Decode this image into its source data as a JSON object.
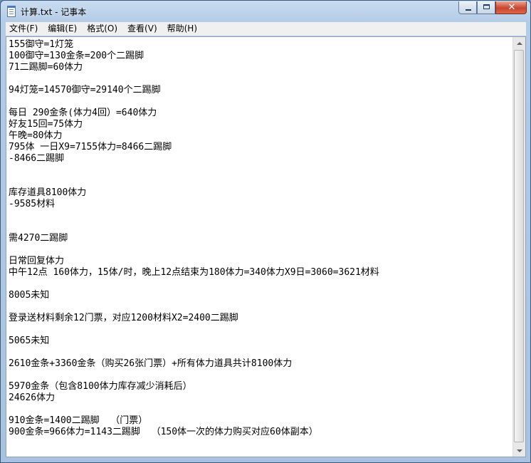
{
  "window": {
    "title": "计算.txt - 记事本"
  },
  "menu": {
    "items": [
      {
        "label": "文件(F)"
      },
      {
        "label": "编辑(E)"
      },
      {
        "label": "格式(O)"
      },
      {
        "label": "查看(V)"
      },
      {
        "label": "帮助(H)"
      }
    ]
  },
  "document": {
    "text": "155御守=1灯笼\n100御守=130金条=200个二踢脚\n71二踢脚=60体力\n\n94灯笼=14570御守=29140个二踢脚\n\n每日 290金条(体力4回）=640体力\n好友15回=75体力\n午晚=80体力\n795体 一日X9=7155体力=8466二踢脚\n-8466二踢脚\n\n\n库存道具8100体力\n-9585材料\n\n\n需4270二踢脚\n\n日常回复体力\n中午12点 160体力，15体/时，晚上12点结束为180体力=340体力X9日=3060=3621材料\n\n8005未知\n\n登录送材料剩余12门票，对应1200材料X2=2400二踢脚\n\n5065未知\n\n2610金条+3360金条（购买26张门票）+所有体力道具共计8100体力\n\n5970金条（包含8100体力库存减少消耗后）\n24626体力\n\n910金条=1400二踢脚  （门票）\n900金条=966体力=1143二踢脚  （150体一次的体力购买对应60体副本）"
  },
  "icons": {
    "app": "notepad-icon",
    "minimize": "minimize-icon",
    "maximize": "maximize-icon",
    "close": "close-icon",
    "scroll_up": "scroll-up-arrow-icon",
    "scroll_down": "scroll-down-arrow-icon"
  },
  "colors": {
    "titlebar": "#b4cbe6",
    "close_button": "#c9452c",
    "menubar": "#f0f0f0",
    "editor_bg": "#ffffff"
  }
}
